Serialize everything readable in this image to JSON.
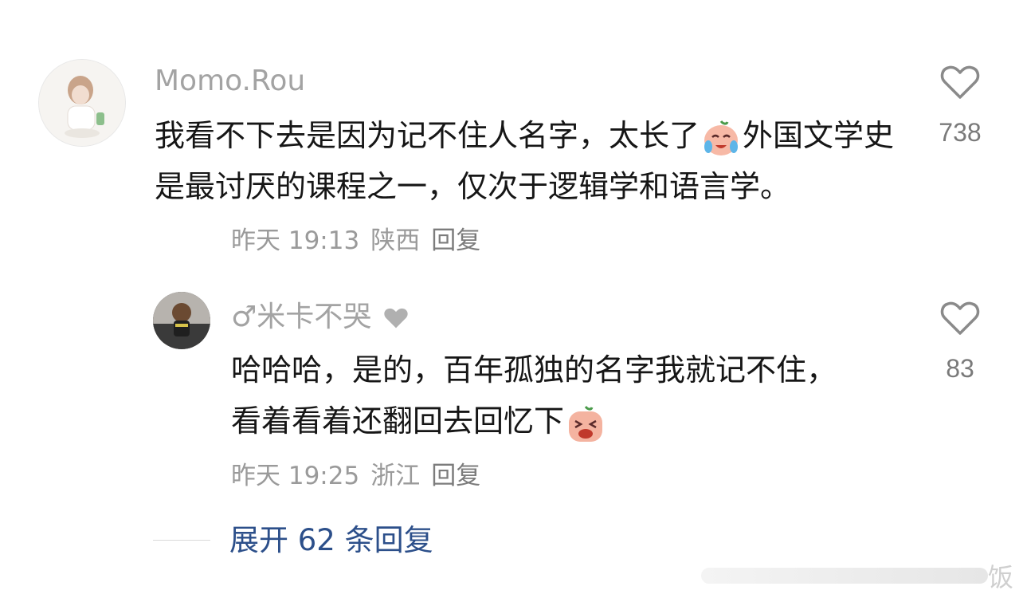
{
  "comments": [
    {
      "username": "Momo.Rou",
      "text_parts": [
        "我看不下去是因为记不住人名字，太长了",
        "外国文学史是最讨厌的课程之一，仅次于逻辑学和语言学。"
      ],
      "emoji": "crying-emoji",
      "time": "昨天 19:13",
      "location": "陕西",
      "reply_label": "回复",
      "likes": "738",
      "like_icon": "heart-outline-icon"
    },
    {
      "username": "♂米卡不哭",
      "username_badge": "heart-icon",
      "text_parts": [
        "哈哈哈，是的，百年孤独的名字我就记不住，看着看着还翻回去回忆下",
        ""
      ],
      "emoji": "wailing-emoji",
      "time": "昨天 19:25",
      "location": "浙江",
      "reply_label": "回复",
      "likes": "83",
      "like_icon": "heart-outline-icon"
    }
  ],
  "expand": {
    "label": "展开 62 条回复"
  },
  "watermark": {
    "text": "饭"
  },
  "colors": {
    "link": "#2c4f8a",
    "muted": "#9a9a9a",
    "text": "#161616"
  }
}
